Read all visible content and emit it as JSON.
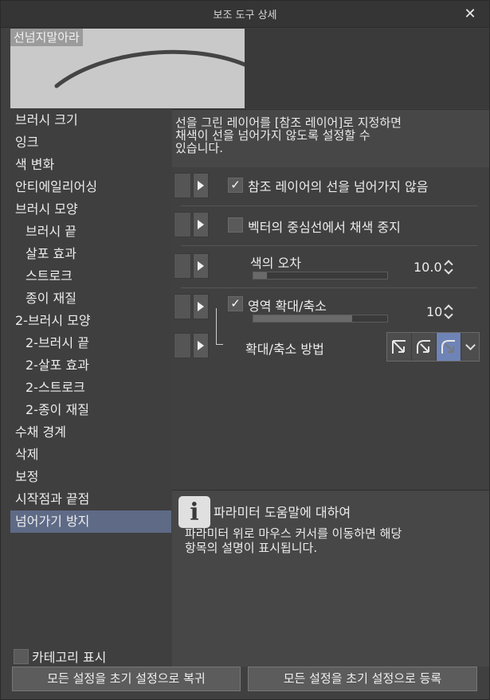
{
  "window": {
    "title": "보조 도구 상세",
    "close_glyph": "✕"
  },
  "preview": {
    "label": "선넘지말아라"
  },
  "sidebar": {
    "items": [
      {
        "label": "브러시 크기"
      },
      {
        "label": "잉크"
      },
      {
        "label": "색 변화"
      },
      {
        "label": "안티에일리어싱"
      },
      {
        "label": "브러시 모양"
      },
      {
        "label": "브러시 끝"
      },
      {
        "label": "살포 효과"
      },
      {
        "label": "스트로크"
      },
      {
        "label": "종이 재질"
      },
      {
        "label": "2-브러시 모양"
      },
      {
        "label": "2-브러시 끝"
      },
      {
        "label": "2-살포 효과"
      },
      {
        "label": "2-스트로크"
      },
      {
        "label": "2-종이 재질"
      },
      {
        "label": "수채 경계"
      },
      {
        "label": "삭제"
      },
      {
        "label": "보정"
      },
      {
        "label": "시작점과 끝점"
      },
      {
        "label": "넘어가기 방지"
      }
    ],
    "selected_index": 18,
    "category_toggle": {
      "label": "카테고리 표시",
      "checked": false
    }
  },
  "description": {
    "line1": "선을 그린 레이어를 [참조 레이어]로 지정하면",
    "line2": "채색이 선을 넘어가지 않도록 설정할 수",
    "line3": "있습니다."
  },
  "settings": {
    "ref_layer": {
      "label": "참조 레이어의 선을 넘어가지 않음",
      "checked": true
    },
    "vector_center": {
      "label": "벡터의 중심선에서 채색 중지",
      "checked": false
    },
    "color_margin": {
      "label": "색의 오차",
      "value": "10.0",
      "level": 0.1
    },
    "area_scaling": {
      "label": "영역 확대/축소",
      "checked": true,
      "value": "10",
      "level": 0.74
    },
    "scaling_method": {
      "label": "확대/축소 방법",
      "options_icons": [
        "scale-square-icon",
        "scale-round-icon",
        "scale-darker-icon"
      ],
      "active_index": 2
    }
  },
  "help": {
    "title": "파라미터 도움말에 대하여",
    "line1": "파라미터 위로 마우스 커서를 이동하면 해당",
    "line2": "항목의 설명이 표시됩니다."
  },
  "buttons": {
    "reset_restore": "모든 설정을 초기 설정으로 복귀",
    "reset_register": "모든 설정을 초기 설정으로 등록"
  },
  "colors": {
    "panel": "#404040",
    "selected": "#5e6a86",
    "active_method": "#6f84b6"
  }
}
